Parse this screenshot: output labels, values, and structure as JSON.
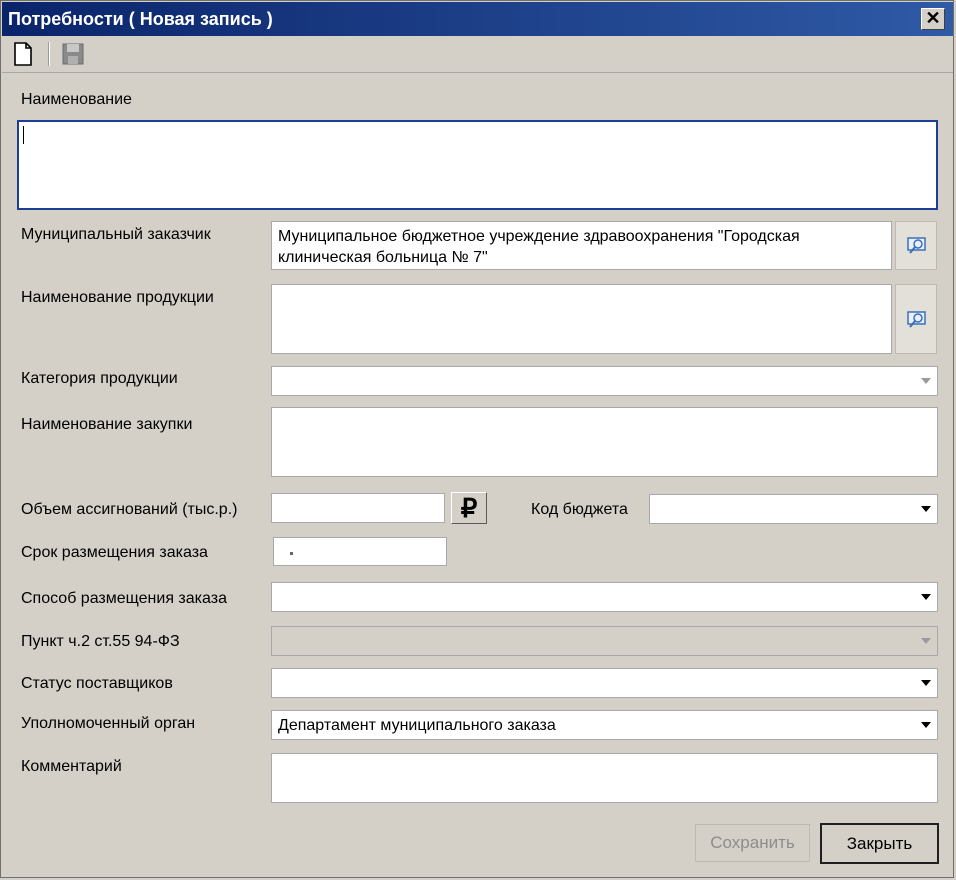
{
  "window": {
    "title": "Потребности ( Новая запись )",
    "close_glyph": "✕"
  },
  "toolbar": {
    "icons": [
      "new-document-icon",
      "save-disk-icon"
    ]
  },
  "form": {
    "name_label": "Наименование",
    "name_value": "",
    "customer_label": "Муниципальный заказчик",
    "customer_value": "Муниципальное бюджетное учреждение здравоохранения \"Городская клиническая больница № 7\"",
    "product_name_label": "Наименование продукции",
    "product_name_value": "",
    "product_category_label": "Категория продукции",
    "product_category_value": "",
    "purchase_name_label": "Наименование закупки",
    "purchase_name_value": "",
    "allocation_label": "Объем ассигнований (тыс.р.)",
    "allocation_value": "",
    "currency_glyph": "₽",
    "budget_code_label": "Код бюджета",
    "budget_code_value": "",
    "order_term_label": "Срок размещения заказа",
    "order_term_value": "",
    "order_method_label": "Способ размещения заказа",
    "order_method_value": "",
    "clause_label": "Пункт ч.2 ст.55 94-ФЗ",
    "clause_value": "",
    "supplier_status_label": "Статус поставщиков",
    "supplier_status_value": "",
    "authorized_body_label": "Уполномоченный орган",
    "authorized_body_value": "Департамент муниципального заказа",
    "comment_label": "Комментарий",
    "comment_value": ""
  },
  "buttons": {
    "save_label": "Сохранить",
    "close_label": "Закрыть"
  },
  "colors": {
    "titlebar_start": "#0a246a",
    "titlebar_end": "#2f5aa6",
    "window_bg": "#d4d0c8",
    "focus_border": "#1c3f94"
  }
}
